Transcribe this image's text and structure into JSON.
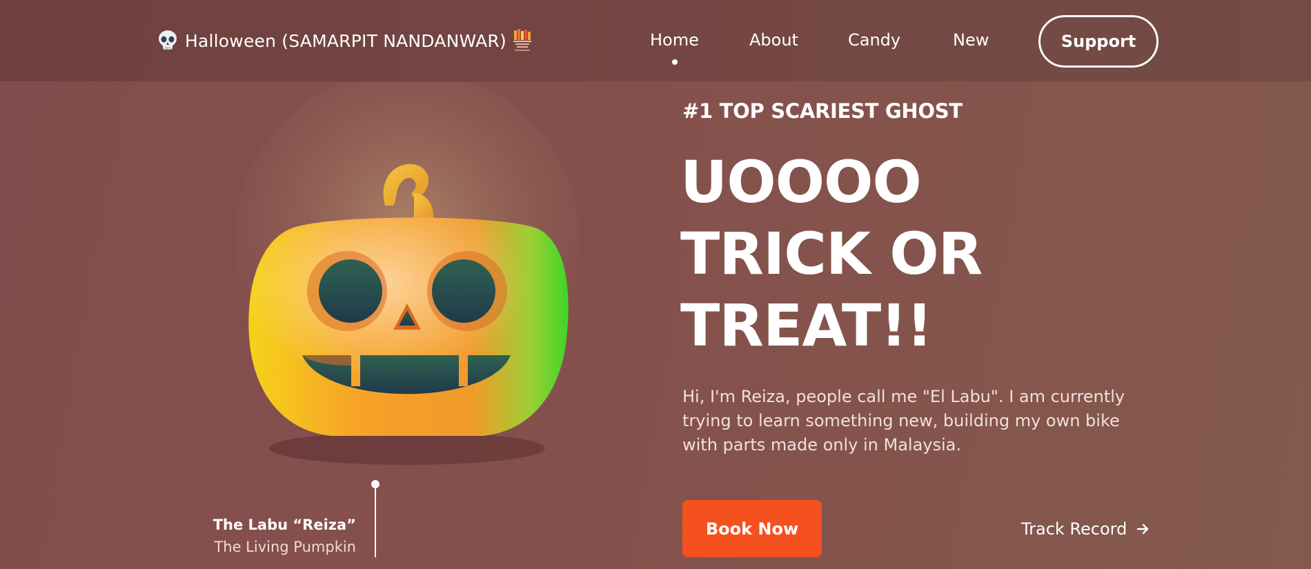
{
  "header": {
    "brand": {
      "title": "Halloween (SAMARPIT NANDANWAR)",
      "icon": "skull-icon",
      "logo_icon": "books-logo-icon"
    },
    "nav": [
      {
        "label": "Home",
        "active": true
      },
      {
        "label": "About",
        "active": false
      },
      {
        "label": "Candy",
        "active": false
      },
      {
        "label": "New",
        "active": false
      }
    ],
    "support_label": "Support"
  },
  "hero": {
    "image_icon": "jack-o-lantern-pumpkin-icon",
    "caption": {
      "title": "The Labu “Reiza”",
      "subtitle": "The Living Pumpkin"
    },
    "eyebrow": "#1 TOP SCARIEST GHOST",
    "headline": [
      "UOOOO",
      "TRICK OR",
      "TREAT!!"
    ],
    "intro": "Hi, I'm Reiza, people call me \"El Labu\". I am currently trying to learn something new, building my own bike with parts made only in Malaysia.",
    "book_label": "Book Now",
    "track_label": "Track Record",
    "track_icon": "arrow-right-icon"
  },
  "colors": {
    "background": "#844f4c",
    "header": "#714442",
    "accent": "#f4511e",
    "text": "#ffffff"
  }
}
